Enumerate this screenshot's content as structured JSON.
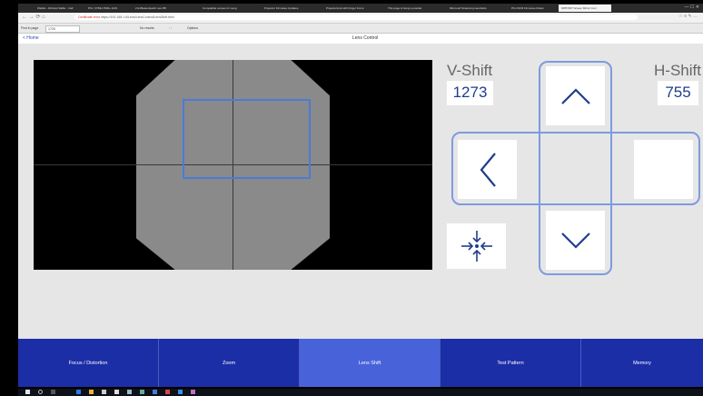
{
  "browser": {
    "tabs": [
      "WebEx - Richard Saffer - Call",
      "Phx | 37MH-7600+ ACS",
      "2 E-Blaster/patch.mov 88",
      "Compatible Lenses for Lang",
      "Projector Firmware Updates",
      "ProjectorLink with Finger Force",
      "This page is being a powder",
      "Microsoft Streaming Heuristics",
      "PK-CSO9 Firmware Model",
      "SPP7407 Screen Mirror Curv"
    ],
    "url": "Certificate error  https://192.168.1.6/Lens/LensControl/LensShift.html",
    "url_scheme": "Certificate error",
    "find": {
      "label": "Find in page",
      "value": "1720",
      "results": "No results",
      "options": "Options"
    }
  },
  "app": {
    "home_label": "< Home",
    "title": "Lens Control"
  },
  "lens_shift": {
    "v_shift_label": "V-Shift",
    "v_shift_value": "1273",
    "h_shift_label": "H-Shift",
    "h_shift_value": "755"
  },
  "nav": {
    "tabs": [
      "Focus / Distortion",
      "Zoom",
      "Lens Shift",
      "Test Pattern",
      "Memory"
    ],
    "active": "Lens Shift"
  },
  "colors": {
    "accent_blue": "#1c2ea6",
    "active_tab": "#4862da",
    "arrow": "#1f3d8c",
    "shift_rect": "#4a7bd8"
  },
  "icons": [
    "up-arrow-icon",
    "left-arrow-icon",
    "down-arrow-icon",
    "center-icon"
  ]
}
